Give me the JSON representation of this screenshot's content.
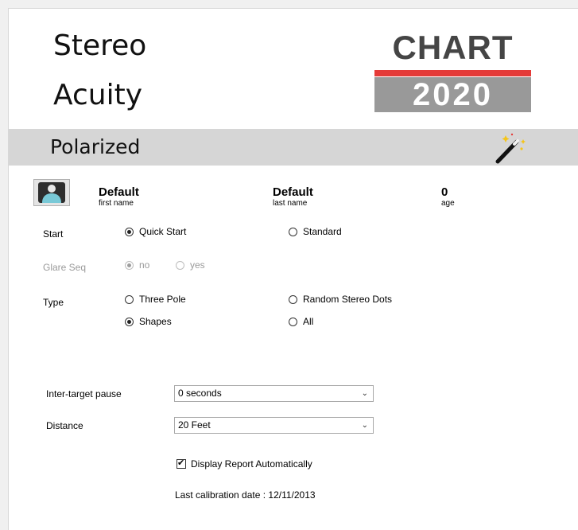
{
  "header": {
    "title_line1": "Stereo",
    "title_line2": "Acuity",
    "logo_top": "CHART",
    "logo_bottom": "2020"
  },
  "band": {
    "title": "Polarized",
    "wand_icon": "magic-wand-icon"
  },
  "patient": {
    "first_name": "Default",
    "first_name_label": "first name",
    "last_name": "Default",
    "last_name_label": "last name",
    "age": "0",
    "age_label": "age"
  },
  "start": {
    "label": "Start",
    "options": [
      "Quick Start",
      "Standard"
    ],
    "selected": "Quick Start"
  },
  "glare": {
    "label": "Glare Seq",
    "options": [
      "no",
      "yes"
    ],
    "selected": "no",
    "enabled": false
  },
  "type": {
    "label": "Type",
    "options": [
      "Three Pole",
      "Random Stereo Dots",
      "Shapes",
      "All"
    ],
    "selected": "Shapes"
  },
  "pause": {
    "label": "Inter-target pause",
    "value": "0 seconds"
  },
  "distance": {
    "label": "Distance",
    "value": "20 Feet"
  },
  "report": {
    "label": "Display Report Automatically",
    "checked": true
  },
  "calibration": {
    "text": "Last calibration date : 12/11/2013"
  },
  "colors": {
    "logo_red": "#e53a38",
    "logo_grey": "#999999",
    "band_grey": "#d6d6d6"
  }
}
